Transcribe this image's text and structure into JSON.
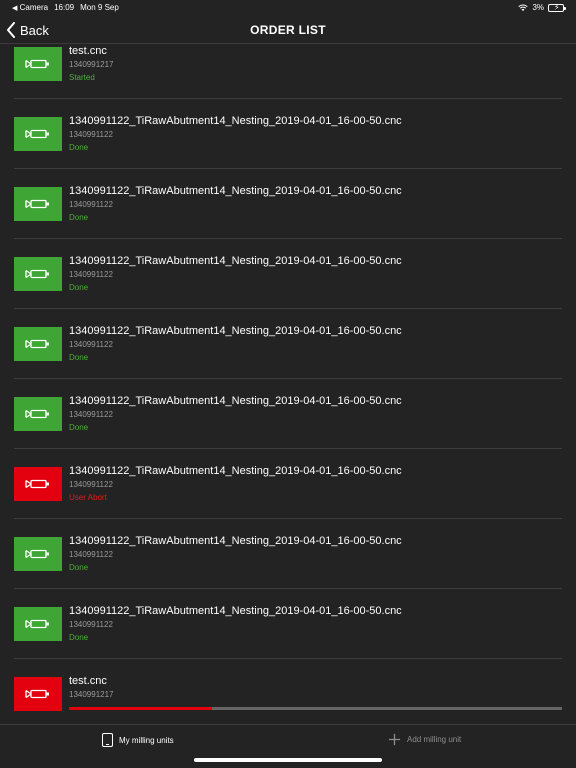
{
  "status_bar": {
    "back_app": "Camera",
    "time": "16:09",
    "date": "Mon 9 Sep",
    "battery": "3%"
  },
  "nav": {
    "back_label": "Back",
    "title": "ORDER LIST"
  },
  "colors": {
    "green": "#3fa535",
    "red": "#e3000f",
    "status_green": "#4caf3a",
    "status_red": "#e21a1a"
  },
  "orders": [
    {
      "name": "test.cnc",
      "id": "1340991217",
      "status": "Started",
      "state": "ok"
    },
    {
      "name": "1340991122_TiRawAbutment14_Nesting_2019-04-01_16-00-50.cnc",
      "id": "1340991122",
      "status": "Done",
      "state": "ok"
    },
    {
      "name": "1340991122_TiRawAbutment14_Nesting_2019-04-01_16-00-50.cnc",
      "id": "1340991122",
      "status": "Done",
      "state": "ok"
    },
    {
      "name": "1340991122_TiRawAbutment14_Nesting_2019-04-01_16-00-50.cnc",
      "id": "1340991122",
      "status": "Done",
      "state": "ok"
    },
    {
      "name": "1340991122_TiRawAbutment14_Nesting_2019-04-01_16-00-50.cnc",
      "id": "1340991122",
      "status": "Done",
      "state": "ok"
    },
    {
      "name": "1340991122_TiRawAbutment14_Nesting_2019-04-01_16-00-50.cnc",
      "id": "1340991122",
      "status": "Done",
      "state": "ok"
    },
    {
      "name": "1340991122_TiRawAbutment14_Nesting_2019-04-01_16-00-50.cnc",
      "id": "1340991122",
      "status": "User Abort",
      "state": "error"
    },
    {
      "name": "1340991122_TiRawAbutment14_Nesting_2019-04-01_16-00-50.cnc",
      "id": "1340991122",
      "status": "Done",
      "state": "ok"
    },
    {
      "name": "1340991122_TiRawAbutment14_Nesting_2019-04-01_16-00-50.cnc",
      "id": "1340991122",
      "status": "Done",
      "state": "ok"
    },
    {
      "name": "test.cnc",
      "id": "1340991217",
      "status": "",
      "state": "error",
      "progress": 0.29
    }
  ],
  "tabs": {
    "milling_units": "My milling units",
    "add_milling_unit": "Add milling unit"
  }
}
